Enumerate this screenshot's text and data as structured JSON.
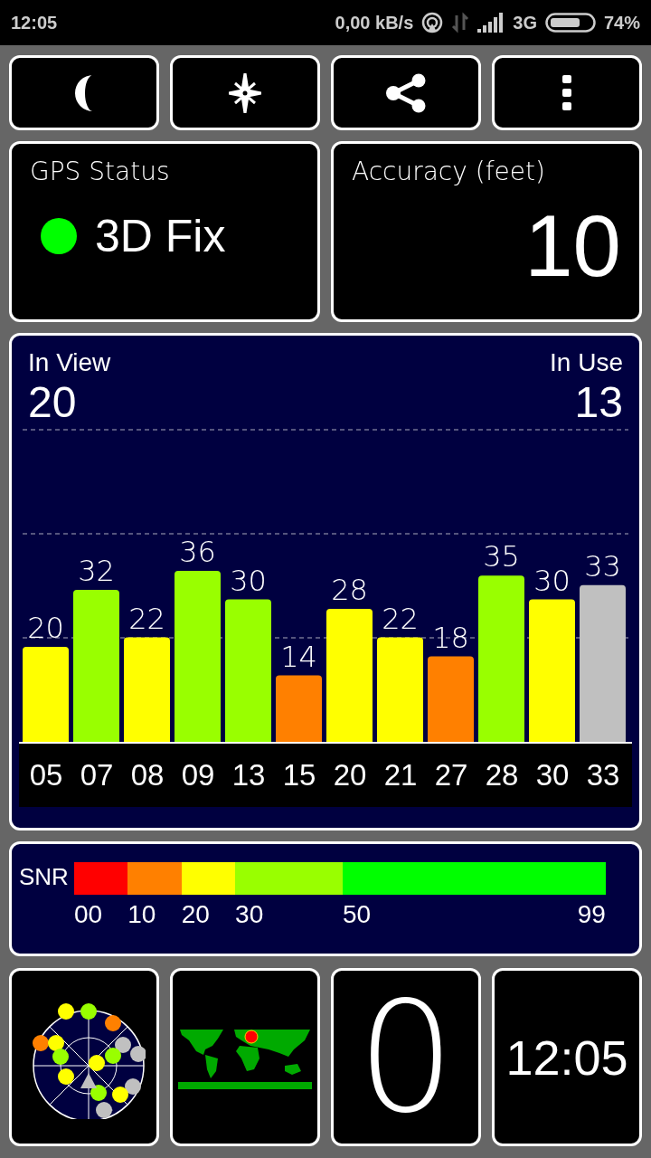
{
  "status_bar": {
    "time": "12:05",
    "speed": "0,00 kB/s",
    "network": "3G",
    "battery": "74%"
  },
  "toolbar": [
    {
      "kind": "night"
    },
    {
      "kind": "compass"
    },
    {
      "kind": "share"
    },
    {
      "kind": "menu"
    }
  ],
  "gps_status": {
    "title": "GPS Status",
    "value": "3D Fix",
    "color": "#00ff00"
  },
  "accuracy": {
    "title": "Accuracy (feet)",
    "value": "10"
  },
  "satellites": {
    "in_view_label": "In View",
    "in_view": "20",
    "in_use_label": "In Use",
    "in_use": "13",
    "chart_data": {
      "type": "bar",
      "categories": [
        "05",
        "07",
        "08",
        "09",
        "13",
        "15",
        "20",
        "21",
        "27",
        "28",
        "30",
        "33"
      ],
      "values": [
        20,
        32,
        22,
        36,
        30,
        14,
        28,
        22,
        18,
        35,
        30,
        33
      ],
      "colors": [
        "#ffff00",
        "#99ff00",
        "#ffff00",
        "#99ff00",
        "#99ff00",
        "#ff8000",
        "#ffff00",
        "#ffff00",
        "#ff8000",
        "#99ff00",
        "#ffff00",
        "#c0c0c0"
      ],
      "data_labels": true
    }
  },
  "snr": {
    "label": "SNR",
    "segments": [
      {
        "label": "00",
        "color": "#ff0000"
      },
      {
        "label": "10",
        "color": "#ff8000"
      },
      {
        "label": "20",
        "color": "#ffff00"
      },
      {
        "label": "30",
        "color": "#99ff00"
      },
      {
        "label": "50",
        "color": "#00ff00"
      }
    ],
    "end_label": "99"
  },
  "tiles": [
    {
      "kind": "skyplot"
    },
    {
      "kind": "map"
    },
    {
      "kind": "number",
      "value": "0"
    },
    {
      "kind": "clock",
      "value": "12:05"
    }
  ]
}
